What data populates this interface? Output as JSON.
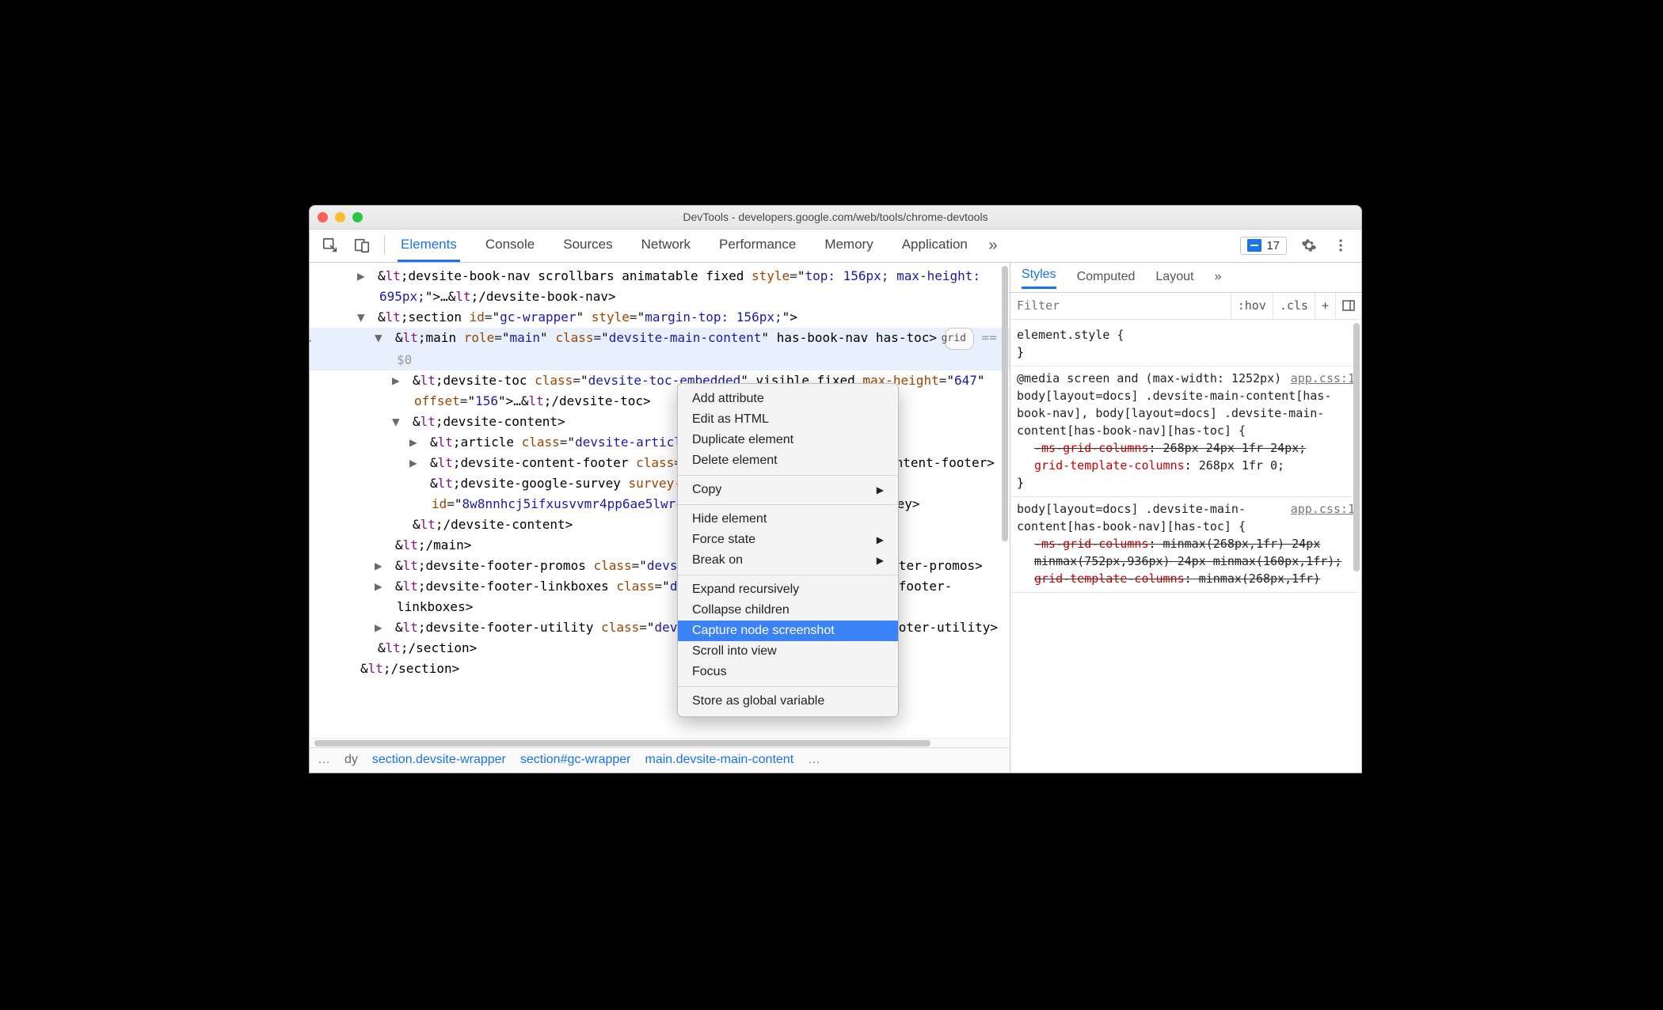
{
  "window": {
    "title": "DevTools - developers.google.com/web/tools/chrome-devtools"
  },
  "toolbar": {
    "tabs": [
      "Elements",
      "Console",
      "Sources",
      "Network",
      "Performance",
      "Memory",
      "Application"
    ],
    "errors_count": "17"
  },
  "dom": {
    "rows": [
      {
        "i": 0,
        "in": 1,
        "caret": "▶",
        "html": "<devsite-book-nav scrollbars animatable fixed style=\"top: 156px; max-height: 695px;\">…</devsite-book-nav>"
      },
      {
        "i": 1,
        "in": 1,
        "caret": "▼",
        "html": "<section id=\"gc-wrapper\" style=\"margin-top: 156px;\">"
      },
      {
        "i": 2,
        "in": 2,
        "caret": "▼",
        "sel": true,
        "first": true,
        "html": "<main role=\"main\" class=\"devsite-main-content\" has-book-nav has-toc>",
        "after_badge": "grid",
        "after_text": " == $0"
      },
      {
        "i": 3,
        "in": 3,
        "caret": "▶",
        "html": "<devsite-toc class=\"devsite-toc-embedded\" visible fixed max-height=\"647\" offset=\"156\">…</devsite-toc>"
      },
      {
        "i": 4,
        "in": 3,
        "caret": "▼",
        "html": "<devsite-content>"
      },
      {
        "i": 5,
        "in": 4,
        "caret": "▶",
        "html": "<article class=\"devsite-article\">…</article>"
      },
      {
        "i": 6,
        "in": 4,
        "caret": "▶",
        "html": "<devsite-content-footer class=\"nocontent\">…</devsite-content-footer>"
      },
      {
        "i": 7,
        "in": 4,
        "caret": "",
        "html": "<devsite-google-survey survey-id=\"8w8nnhcj5ifxusvvmr4pp6ae5lwrctq\"></devsite-google-survey>"
      },
      {
        "i": 8,
        "in": 3,
        "caret": "",
        "html": "</devsite-content>"
      },
      {
        "i": 9,
        "in": 2,
        "caret": "",
        "html": "</main>"
      },
      {
        "i": 10,
        "in": 2,
        "caret": "▶",
        "html": "<devsite-footer-promos class=\"devsite-footer\">…</devsite-footer-promos>"
      },
      {
        "i": 11,
        "in": 2,
        "caret": "▶",
        "html": "<devsite-footer-linkboxes class=\"devsite-footer\">…</devsite-footer-linkboxes>"
      },
      {
        "i": 12,
        "in": 2,
        "caret": "▶",
        "html": "<devsite-footer-utility class=\"devsite-footer\">…</devsite-footer-utility>"
      },
      {
        "i": 13,
        "in": 1,
        "caret": "",
        "html": "</section>"
      },
      {
        "i": 14,
        "in": 0,
        "caret": "",
        "html": "</section>"
      }
    ]
  },
  "crumbs": {
    "items": [
      "…",
      "dy",
      "section.devsite-wrapper",
      "section#gc-wrapper",
      "main.devsite-main-content",
      "…"
    ]
  },
  "ctx": {
    "groups": [
      [
        {
          "t": "Add attribute"
        },
        {
          "t": "Edit as HTML"
        },
        {
          "t": "Duplicate element"
        },
        {
          "t": "Delete element"
        }
      ],
      [
        {
          "t": "Copy",
          "sub": true
        }
      ],
      [
        {
          "t": "Hide element"
        },
        {
          "t": "Force state",
          "sub": true
        },
        {
          "t": "Break on",
          "sub": true
        }
      ],
      [
        {
          "t": "Expand recursively"
        },
        {
          "t": "Collapse children"
        },
        {
          "t": "Capture node screenshot",
          "hl": true
        },
        {
          "t": "Scroll into view"
        },
        {
          "t": "Focus"
        }
      ],
      [
        {
          "t": "Store as global variable"
        }
      ]
    ]
  },
  "styles": {
    "tabs": [
      "Styles",
      "Computed",
      "Layout"
    ],
    "filter_placeholder": "Filter",
    "filter_buttons": [
      ":hov",
      ".cls",
      "+"
    ],
    "rules": [
      {
        "selector": "element.style {",
        "link": "",
        "lines": [],
        "close": "}"
      },
      {
        "selector": "@media screen and (max-width: 1252px)\nbody[layout=docs] .devsite-main-content[has-book-nav], body[layout=docs] .devsite-main-content[has-book-nav][has-toc] {",
        "link": "app.css:1",
        "lines": [
          {
            "n": "-ms-grid-columns",
            "v": " 268px 24px 1fr 24px;",
            "st": true
          },
          {
            "n": "grid-template-columns",
            "v": " 268px 1fr 0;"
          }
        ],
        "close": "}"
      },
      {
        "selector": "body[layout=docs] .devsite-main-content[has-book-nav][has-toc] {",
        "link": "app.css:1",
        "lines": [
          {
            "n": "-ms-grid-columns",
            "v": " minmax(268px,1fr) 24px minmax(752px,936px) 24px minmax(160px,1fr);",
            "st": true
          },
          {
            "n": "grid-template-columns",
            "v": " minmax(268px,1fr)",
            "st": true
          }
        ],
        "close": ""
      }
    ]
  }
}
